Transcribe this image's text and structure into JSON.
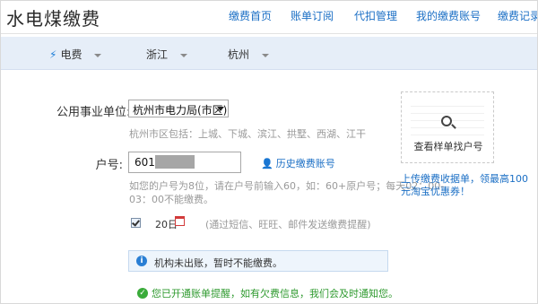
{
  "header": {
    "logo": "水电煤缴费",
    "nav": [
      "缴费首页",
      "账单订阅",
      "代扣管理",
      "我的缴费账号",
      "缴费记录"
    ]
  },
  "category_bar": {
    "type": "电费",
    "province": "浙江",
    "city": "杭州"
  },
  "form": {
    "unit_label": "公用事业单位:",
    "unit_value": "杭州市电力局(市区)",
    "unit_hint": "杭州市区包括：上城、下城、滨江、拱墅、西湖、江干",
    "account_label": "户号:",
    "account_value": "601",
    "history_link": "历史缴费账号",
    "account_hint_line1": "如您的户号为8位，请在户号前输入60，如：60+原户号；每天02：00-",
    "account_hint_line2": "03：00不能缴费。",
    "reminder_day": "20日",
    "reminder_hint": "(通过短信、旺旺、邮件发送缴费提醒)",
    "info_message": "机构未出账，暂时不能缴费。",
    "success_message": "您已开通账单提醒，如有欠费信息，我们会及时通知您。"
  },
  "sample": {
    "caption": "查看样单找户号"
  },
  "promo": {
    "text": "上传缴费收据单，领最高100元淘宝优惠券！"
  },
  "colors": {
    "link": "#1b6fc5",
    "category_bar": "#e6eef8",
    "success": "#2f9a2f",
    "info_bg": "#eef5fc"
  }
}
